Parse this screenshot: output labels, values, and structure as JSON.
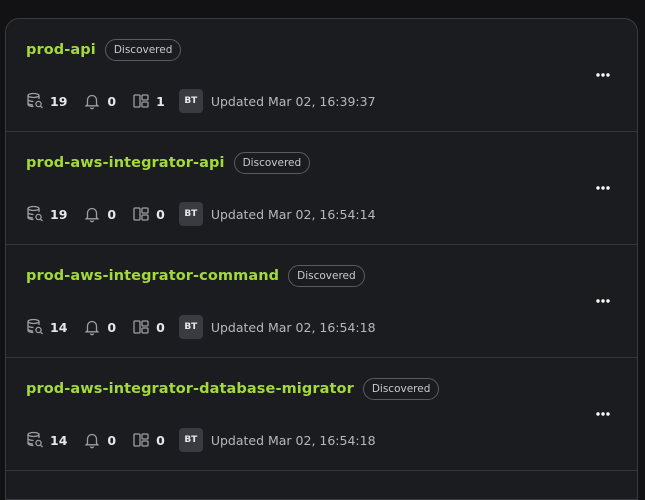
{
  "services": [
    {
      "name": "prod-api",
      "status": "Discovered",
      "databases": "19",
      "alerts": "0",
      "components": "1",
      "avatar": "BT",
      "updated": "Updated Mar 02, 16:39:37"
    },
    {
      "name": "prod-aws-integrator-api",
      "status": "Discovered",
      "databases": "19",
      "alerts": "0",
      "components": "0",
      "avatar": "BT",
      "updated": "Updated Mar 02, 16:54:14"
    },
    {
      "name": "prod-aws-integrator-command",
      "status": "Discovered",
      "databases": "14",
      "alerts": "0",
      "components": "0",
      "avatar": "BT",
      "updated": "Updated Mar 02, 16:54:18"
    },
    {
      "name": "prod-aws-integrator-database-migrator",
      "status": "Discovered",
      "databases": "14",
      "alerts": "0",
      "components": "0",
      "avatar": "BT",
      "updated": "Updated Mar 02, 16:54:18"
    }
  ],
  "icons": {
    "databases": "database-search-icon",
    "alerts": "bell-icon",
    "components": "layout-grid-icon",
    "menu": "more-horizontal-icon"
  },
  "colors": {
    "accent": "#a3d93b",
    "panel_bg": "#1b1c1f",
    "page_bg": "#121214"
  }
}
